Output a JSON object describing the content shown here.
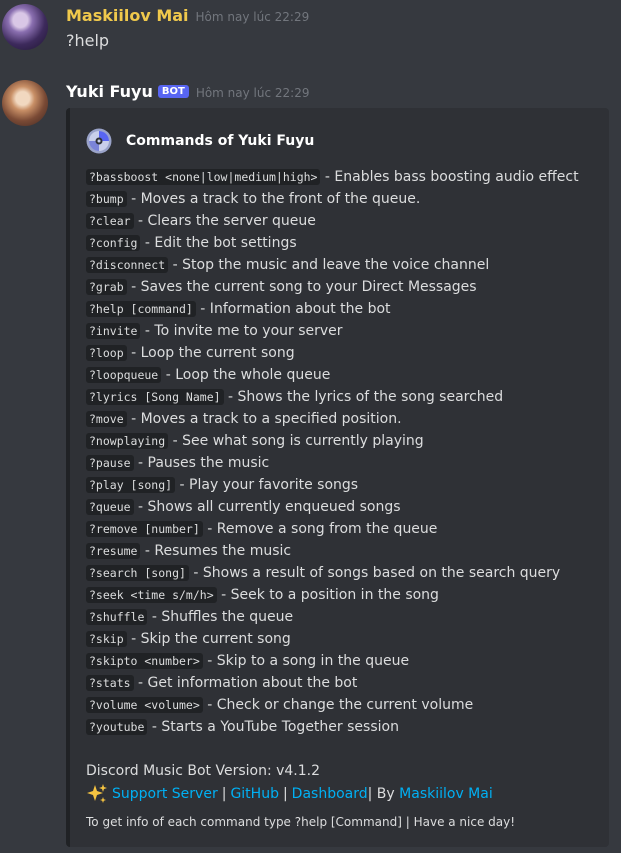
{
  "messages": [
    {
      "author": "Maskiilov Mai",
      "timestamp": "Hôm nay lúc 22:29",
      "content": "?help"
    },
    {
      "author": "Yuki Fuyu",
      "bot_tag": "BOT",
      "timestamp": "Hôm nay lúc 22:29"
    }
  ],
  "embed": {
    "author_name": "Commands of Yuki Fuyu",
    "author_icon": "disc-icon",
    "commands": [
      {
        "cmd": "?bassboost <none|low|medium|high>",
        "desc": " - Enables bass boosting audio effect"
      },
      {
        "cmd": "?bump",
        "desc": " - Moves a track to the front of the queue."
      },
      {
        "cmd": "?clear",
        "desc": " - Clears the server queue"
      },
      {
        "cmd": "?config",
        "desc": " - Edit the bot settings"
      },
      {
        "cmd": "?disconnect",
        "desc": " - Stop the music and leave the voice channel"
      },
      {
        "cmd": "?grab",
        "desc": " - Saves the current song to your Direct Messages"
      },
      {
        "cmd": "?help [command]",
        "desc": " - Information about the bot"
      },
      {
        "cmd": "?invite",
        "desc": " - To invite me to your server"
      },
      {
        "cmd": "?loop",
        "desc": " - Loop the current song"
      },
      {
        "cmd": "?loopqueue",
        "desc": " - Loop the whole queue"
      },
      {
        "cmd": "?lyrics [Song Name]",
        "desc": " - Shows the lyrics of the song searched"
      },
      {
        "cmd": "?move",
        "desc": " - Moves a track to a specified position."
      },
      {
        "cmd": "?nowplaying",
        "desc": " - See what song is currently playing"
      },
      {
        "cmd": "?pause",
        "desc": " - Pauses the music"
      },
      {
        "cmd": "?play [song]",
        "desc": " - Play your favorite songs"
      },
      {
        "cmd": "?queue",
        "desc": " - Shows all currently enqueued songs"
      },
      {
        "cmd": "?remove [number]",
        "desc": " - Remove a song from the queue"
      },
      {
        "cmd": "?resume",
        "desc": " - Resumes the music"
      },
      {
        "cmd": "?search [song]",
        "desc": " - Shows a result of songs based on the search query"
      },
      {
        "cmd": "?seek <time s/m/h>",
        "desc": " - Seek to a position in the song"
      },
      {
        "cmd": "?shuffle",
        "desc": " - Shuffles the queue"
      },
      {
        "cmd": "?skip",
        "desc": " - Skip the current song"
      },
      {
        "cmd": "?skipto <number>",
        "desc": " - Skip to a song in the queue"
      },
      {
        "cmd": "?stats",
        "desc": " - Get information about the bot"
      },
      {
        "cmd": "?volume <volume>",
        "desc": " - Check or change the current volume"
      },
      {
        "cmd": "?youtube",
        "desc": " - Starts a YouTube Together session"
      }
    ],
    "version_text": "Discord Music Bot Version: v4.1.2",
    "sparkle_icon": "sparkles-icon",
    "links": {
      "support": "Support Server",
      "sep": "|",
      "github": "GitHub",
      "dashboard": "Dashboard",
      "by_text": "| By ",
      "author": "Maskiilov Mai"
    },
    "footer": "To get info of each command type ?help [Command] | Have a nice day!"
  },
  "colors": {
    "background": "#36393f",
    "embed_bg": "#2f3136",
    "link": "#00b0f4",
    "username_1": "#f0c94c",
    "bot_tag": "#5865f2"
  }
}
